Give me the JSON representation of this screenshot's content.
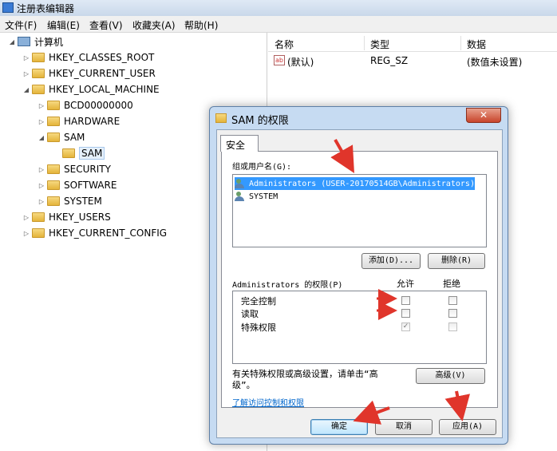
{
  "window": {
    "title": "注册表编辑器"
  },
  "menu": [
    "文件(F)",
    "编辑(E)",
    "查看(V)",
    "收藏夹(A)",
    "帮助(H)"
  ],
  "tree": {
    "root": "计算机",
    "items": [
      "HKEY_CLASSES_ROOT",
      "HKEY_CURRENT_USER",
      "HKEY_LOCAL_MACHINE",
      "BCD00000000",
      "HARDWARE",
      "SAM",
      "SAM",
      "SECURITY",
      "SOFTWARE",
      "SYSTEM",
      "HKEY_USERS",
      "HKEY_CURRENT_CONFIG"
    ]
  },
  "list": {
    "headers": [
      "名称",
      "类型",
      "数据"
    ],
    "rows": [
      {
        "name": "(默认)",
        "type": "REG_SZ",
        "data": "(数值未设置)",
        "icon": "ab-string-icon"
      }
    ]
  },
  "dialog": {
    "title": "SAM 的权限",
    "close": "✕",
    "tab": "安全",
    "group_label": "组或用户名(G):",
    "users": [
      "Administrators (USER-20170514GB\\Administrators)",
      "SYSTEM"
    ],
    "add_button": "添加(D)...",
    "remove_button": "删除(R)",
    "perm_label": "Administrators 的权限(P)",
    "allow_col": "允许",
    "deny_col": "拒绝",
    "permissions": [
      {
        "name": "完全控制",
        "allow": false,
        "deny": false
      },
      {
        "name": "读取",
        "allow": false,
        "deny": false
      },
      {
        "name": "特殊权限",
        "allow": true,
        "deny": false
      }
    ],
    "advanced_text_1": "有关特殊权限或高级设置，请单击“高",
    "advanced_text_2": "级”。",
    "advanced_button": "高级(V)",
    "link": "了解访问控制和权限",
    "ok_button": "确定",
    "cancel_button": "取消",
    "apply_button": "应用(A)"
  },
  "colors": {
    "annotation_arrow": "#e0352b",
    "selection": "#3399ff"
  }
}
